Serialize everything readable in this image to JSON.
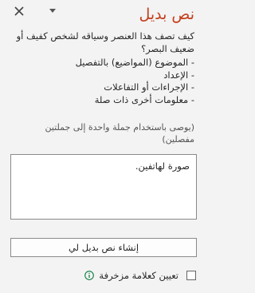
{
  "pane": {
    "title": "نص بديل",
    "close_icon": "close-icon",
    "options_icon": "chevron-down-icon"
  },
  "description": {
    "question": "كيف تصف هذا العنصر وسياقه لشخص كفيف أو ضعيف البصر؟",
    "bullets": [
      "- الموضوع (المواضيع) بالتفصيل",
      "- الإعداد",
      "- الإجراءات أو التفاعلات",
      "- معلومات أخرى ذات صلة"
    ]
  },
  "hint": "(يوصى باستخدام جملة واحدة إلى جملتين مفصلين)",
  "alt_text": {
    "value": "صورة لهاتفين."
  },
  "generate_button": {
    "label": "إنشاء نص بديل لي"
  },
  "decorative": {
    "label": "تعيين كعلامة مزخرفة",
    "checked": false,
    "info_icon": "info-icon"
  },
  "colors": {
    "title": "#c43e1c",
    "background": "#f3f3f3",
    "info_icon": "#107c41"
  }
}
